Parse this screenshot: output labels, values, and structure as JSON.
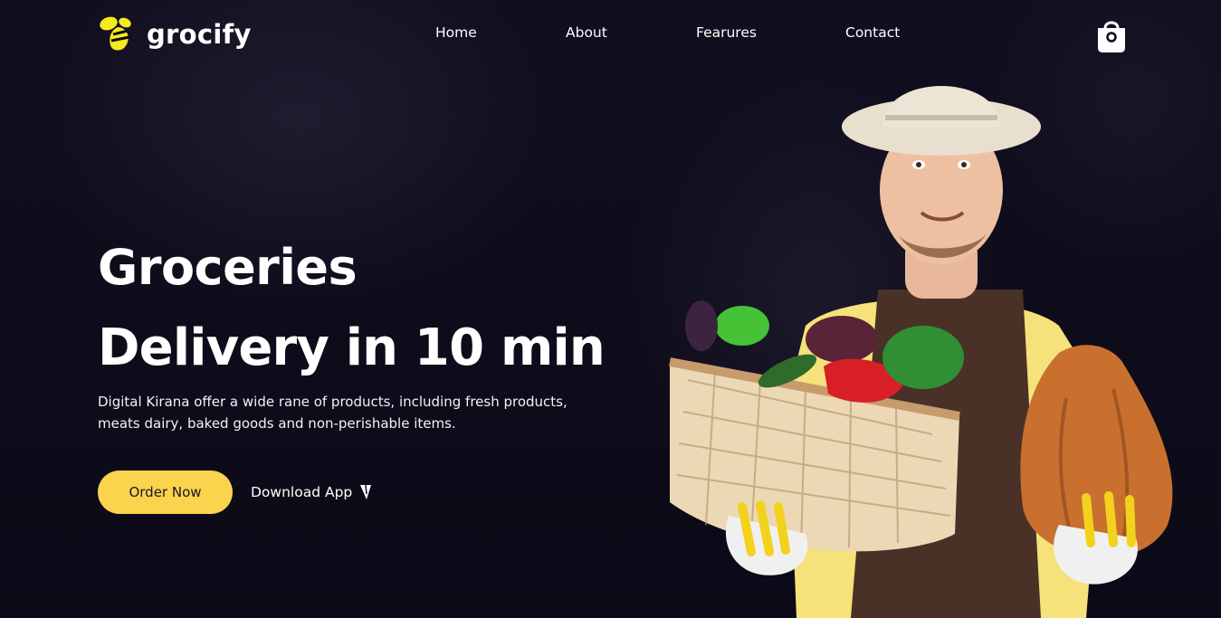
{
  "brand": {
    "name": "grocify",
    "logo_icon": "bee-icon",
    "accent_color": "#fcd34d"
  },
  "nav": {
    "items": [
      {
        "label": "Home"
      },
      {
        "label": "About"
      },
      {
        "label": "Fearures"
      },
      {
        "label": "Contact"
      }
    ],
    "cart_icon": "shopping-bag-icon"
  },
  "hero": {
    "title_line1": "Groceries",
    "title_line2": "Delivery in 10 min",
    "description": "Digital Kirana offer a wide rane of products, including fresh products, meats dairy, baked goods and non-perishable items.",
    "primary_button": "Order Now",
    "secondary_button": "Download App",
    "secondary_icon": "cursor-arrow-icon",
    "image_icon": "farmer-with-vegetable-basket-image"
  }
}
